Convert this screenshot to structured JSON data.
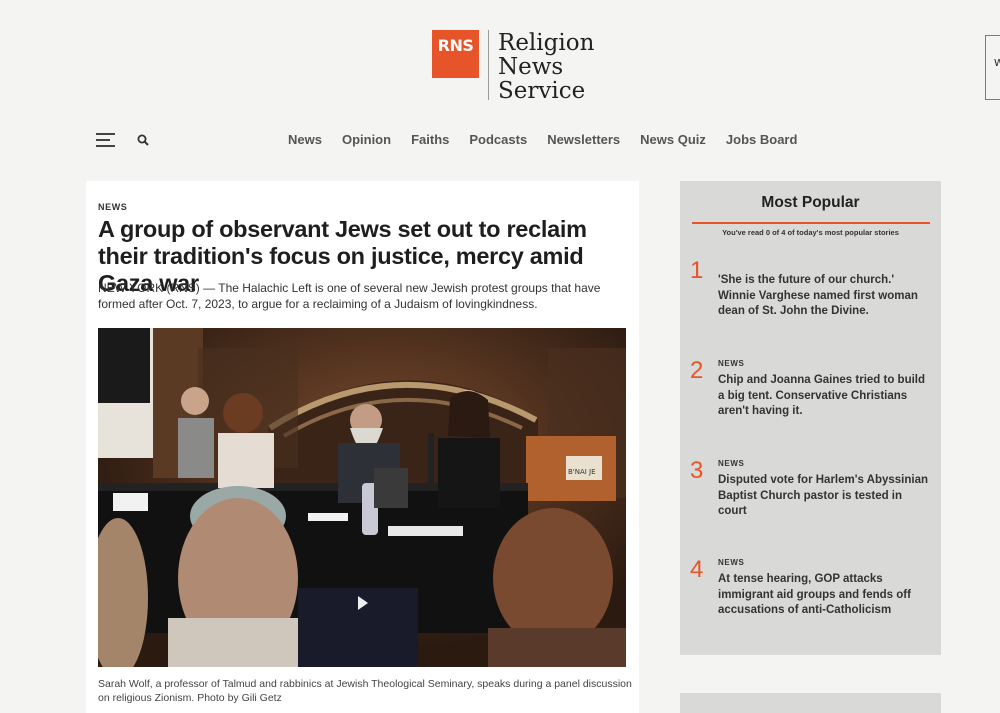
{
  "logo": {
    "mark": "RNS",
    "line1": "Religion",
    "line2": "News",
    "line3": "Service"
  },
  "side_tab": {
    "label": "W"
  },
  "nav": {
    "items": [
      "News",
      "Opinion",
      "Faiths",
      "Podcasts",
      "Newsletters",
      "News Quiz",
      "Jobs Board"
    ]
  },
  "article": {
    "kicker": "NEWS",
    "headline": "A group of observant Jews set out to reclaim their tradition's focus on justice, mercy amid Gaza war",
    "dek": "NEW YORK (RNS) — The Halachic Left is one of several new Jewish protest groups that have formed after Oct. 7, 2023, to argue for a reclaiming of a Judaism of lovingkindness.",
    "caption": "Sarah Wolf, a professor of Talmud and rabbinics at Jewish Theological Seminary, speaks during a panel discussion on religious Zionism. Photo by Gili Getz",
    "photo_sign": "B'NAI JE"
  },
  "popular": {
    "title": "Most Popular",
    "subtitle": "You've read 0 of 4 of today's most popular stories",
    "items": [
      {
        "num": "1",
        "kicker": "",
        "title": "'She is the future of our church.' Winnie Varghese named first woman dean of St. John the Divine."
      },
      {
        "num": "2",
        "kicker": "NEWS",
        "title": "Chip and Joanna Gaines tried to build a big tent. Conservative Christians aren't having it."
      },
      {
        "num": "3",
        "kicker": "NEWS",
        "title": "Disputed vote for Harlem's Abyssinian Baptist Church pastor is tested in court"
      },
      {
        "num": "4",
        "kicker": "NEWS",
        "title": "At tense hearing, GOP attacks immigrant aid groups and fends off accusations of anti-Catholicism"
      }
    ]
  },
  "colors": {
    "accent": "#e8542a",
    "sidebar_bg": "#d9d9d7",
    "page_bg": "#f4f4f2"
  }
}
